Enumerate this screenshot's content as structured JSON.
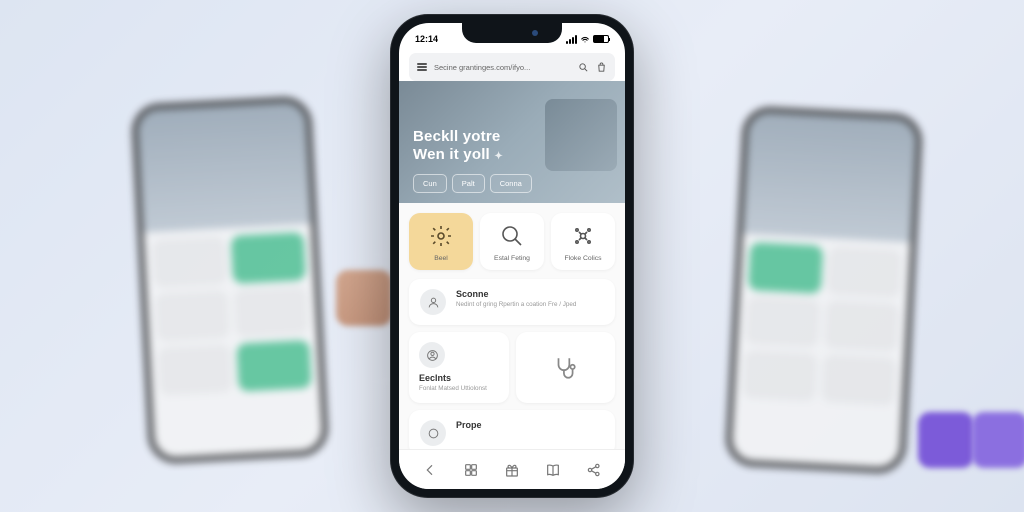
{
  "statusBar": {
    "time": "12:14"
  },
  "urlBar": {
    "url": "Secine grantinges.com/ifyo..."
  },
  "hero": {
    "line1": "Beckll yotre",
    "line2": "Wen it yoll",
    "star": "✦"
  },
  "chips": [
    {
      "label": "Cun"
    },
    {
      "label": "Palt"
    },
    {
      "label": "Conna"
    }
  ],
  "tiles": [
    {
      "label": "Beel",
      "highlight": true,
      "icon": "gear"
    },
    {
      "label": "Estal Feting",
      "icon": "search"
    },
    {
      "label": "Floke Colics",
      "icon": "sparkle"
    }
  ],
  "listCard": {
    "title": "Sconne",
    "sub": "Nedint of gring\nRpertin a coation\nFre / Jped",
    "icon": "person"
  },
  "smallCards": [
    {
      "title": "Eeclnts",
      "sub": "Fonlat Matsed\nUttiolonst",
      "icon": "person-ring"
    },
    {
      "icon": "stethoscope"
    }
  ],
  "peekCard": {
    "title": "Prope"
  },
  "colors": {
    "accent": "#f4d89a"
  }
}
